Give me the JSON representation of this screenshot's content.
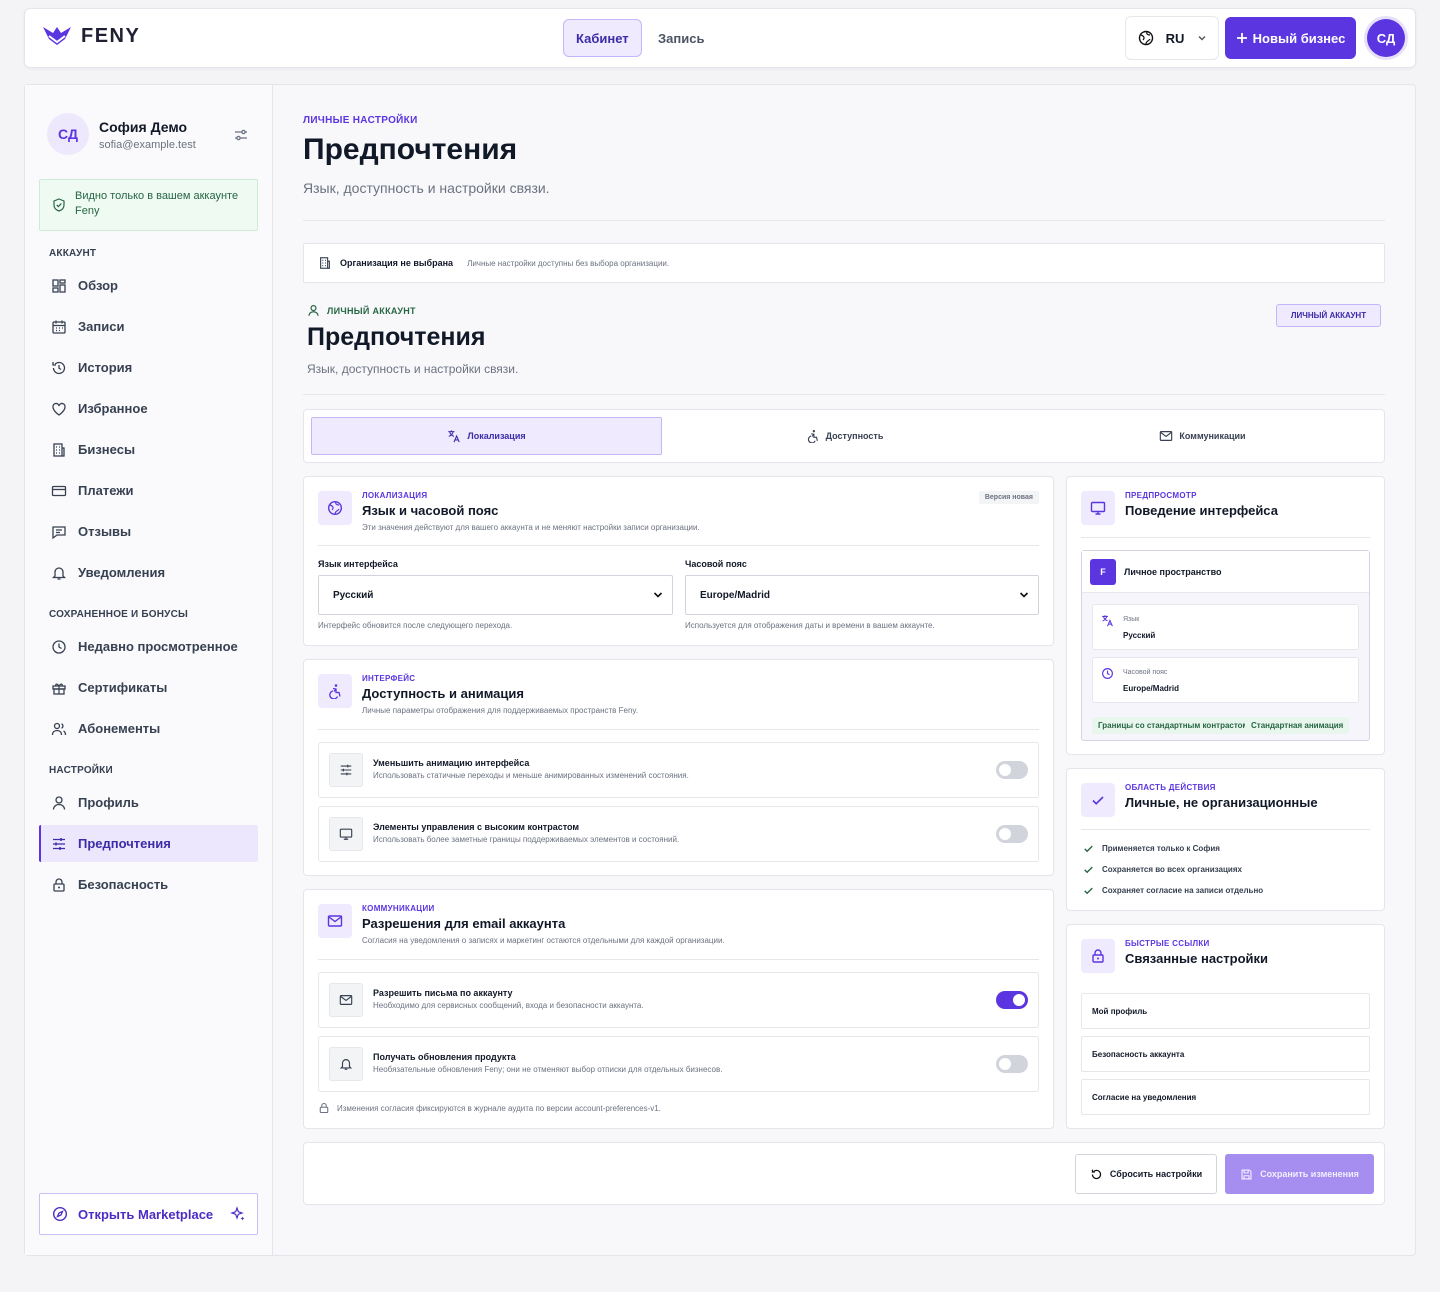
{
  "header": {
    "brand": "FENY",
    "nav": [
      {
        "label": "Кабинет",
        "active": true
      },
      {
        "label": "Запись",
        "active": false
      }
    ],
    "language": "RU",
    "new_business": "Новый бизнес",
    "avatar": "СД"
  },
  "sidebar": {
    "user": {
      "initials": "СД",
      "name": "София Демо",
      "email": "sofia@example.test"
    },
    "notice": "Видно только в вашем аккаунте Feny",
    "sections": [
      {
        "title": "АККАУНТ",
        "items": [
          {
            "label": "Обзор",
            "icon": "grid-icon"
          },
          {
            "label": "Записи",
            "icon": "calendar-icon"
          },
          {
            "label": "История",
            "icon": "history-icon"
          },
          {
            "label": "Избранное",
            "icon": "heart-icon"
          },
          {
            "label": "Бизнесы",
            "icon": "building-icon"
          },
          {
            "label": "Платежи",
            "icon": "card-icon"
          },
          {
            "label": "Отзывы",
            "icon": "message-icon"
          },
          {
            "label": "Уведомления",
            "icon": "bell-icon"
          }
        ]
      },
      {
        "title": "СОХРАНЕННОЕ И БОНУСЫ",
        "items": [
          {
            "label": "Недавно просмотренное",
            "icon": "clock-icon"
          },
          {
            "label": "Сертификаты",
            "icon": "gift-icon"
          },
          {
            "label": "Абонементы",
            "icon": "users-icon"
          }
        ]
      },
      {
        "title": "НАСТРОЙКИ",
        "items": [
          {
            "label": "Профиль",
            "icon": "user-icon"
          },
          {
            "label": "Предпочтения",
            "icon": "sliders-icon",
            "active": true
          },
          {
            "label": "Безопасность",
            "icon": "lock-icon"
          }
        ]
      }
    ],
    "marketplace": "Открыть Marketplace"
  },
  "page": {
    "overline": "ЛИЧНЫЕ НАСТРОЙКИ",
    "title": "Предпочтения",
    "subtitle": "Язык, доступность и настройки связи."
  },
  "org_banner": {
    "title": "Организация не выбрана",
    "text": "Личные настройки доступны без выбора организации."
  },
  "section": {
    "overline": "ЛИЧНЫЙ АККАУНТ",
    "title": "Предпочтения",
    "subtitle": "Язык, доступность и настройки связи.",
    "badge": "ЛИЧНЫЙ АККАУНТ"
  },
  "tabs": [
    {
      "label": "Локализация",
      "icon": "translate-icon",
      "active": true
    },
    {
      "label": "Доступность",
      "icon": "accessibility-icon",
      "active": false
    },
    {
      "label": "Коммуникации",
      "icon": "mail-icon",
      "active": false
    }
  ],
  "localization": {
    "overline": "ЛОКАЛИЗАЦИЯ",
    "title": "Язык и часовой пояс",
    "subtitle": "Эти значения действуют для вашего аккаунта и не меняют настройки записи организации.",
    "version": "Версия новая",
    "language_label": "Язык интерфейса",
    "language_value": "Русский",
    "language_hint": "Интерфейс обновится после следующего перехода.",
    "timezone_label": "Часовой пояс",
    "timezone_value": "Europe/Madrid",
    "timezone_hint": "Используется для отображения даты и времени в вашем аккаунте."
  },
  "accessibility": {
    "overline": "ИНТЕРФЕЙС",
    "title": "Доступность и анимация",
    "subtitle": "Личные параметры отображения для поддерживаемых пространств Feny.",
    "items": [
      {
        "title": "Уменьшить анимацию интерфейса",
        "desc": "Использовать статичные переходы и меньше анимированных изменений состояния.",
        "on": false
      },
      {
        "title": "Элементы управления с высоким контрастом",
        "desc": "Использовать более заметные границы поддерживаемых элементов и состояний.",
        "on": false
      }
    ]
  },
  "communications": {
    "overline": "КОММУНИКАЦИИ",
    "title": "Разрешения для email аккаунта",
    "subtitle": "Согласия на уведомления о записях и маркетинг остаются отдельными для каждой организации.",
    "items": [
      {
        "title": "Разрешить письма по аккаунту",
        "desc": "Необходимо для сервисных сообщений, входа и безопасности аккаунта.",
        "on": true
      },
      {
        "title": "Получать обновления продукта",
        "desc": "Необязательные обновления Feny; они не отменяют выбор отписки для отдельных бизнесов.",
        "on": false
      }
    ],
    "audit": "Изменения согласия фиксируются в журнале аудита по версии account-preferences-v1."
  },
  "preview": {
    "overline": "ПРЕДПРОСМОТР",
    "title": "Поведение интерфейса",
    "space_badge": "F",
    "space_title": "Личное пространство",
    "lang_label": "Язык",
    "lang_value": "Русский",
    "tz_label": "Часовой пояс",
    "tz_value": "Europe/Madrid",
    "pills": [
      "Границы со стандартным контрастом",
      "Стандартная анимация"
    ]
  },
  "scope": {
    "overline": "ОБЛАСТЬ ДЕЙСТВИЯ",
    "title": "Личные, не организационные",
    "items": [
      "Применяется только к София",
      "Сохраняется во всех организациях",
      "Сохраняет согласие на записи отдельно"
    ]
  },
  "quick_links": {
    "overline": "БЫСТРЫЕ ССЫЛКИ",
    "title": "Связанные настройки",
    "items": [
      "Мой профиль",
      "Безопасность аккаунта",
      "Согласие на уведомления"
    ]
  },
  "actions": {
    "reset": "Сбросить настройки",
    "save": "Сохранить изменения"
  },
  "colors": {
    "accent": "#5b35e0",
    "success": "#276643"
  }
}
